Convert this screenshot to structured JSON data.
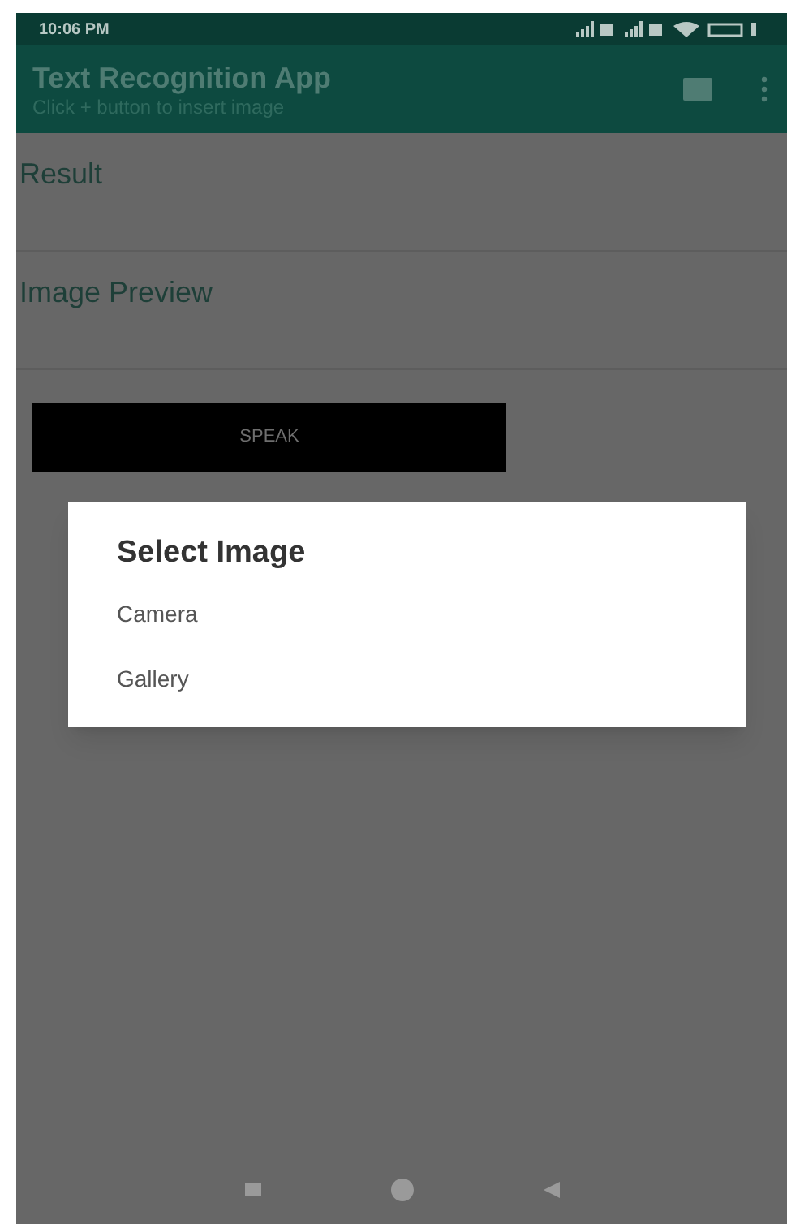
{
  "status_bar": {
    "time": "10:06 PM"
  },
  "app_bar": {
    "title": "Text Recognition App",
    "subtitle": "Click + button to insert image"
  },
  "sections": [
    {
      "label": "Result"
    },
    {
      "label": "Image Preview"
    }
  ],
  "speak_button": {
    "label": "SPEAK"
  },
  "dialog": {
    "title": "Select Image",
    "options": [
      {
        "label": "Camera"
      },
      {
        "label": "Gallery"
      }
    ]
  }
}
